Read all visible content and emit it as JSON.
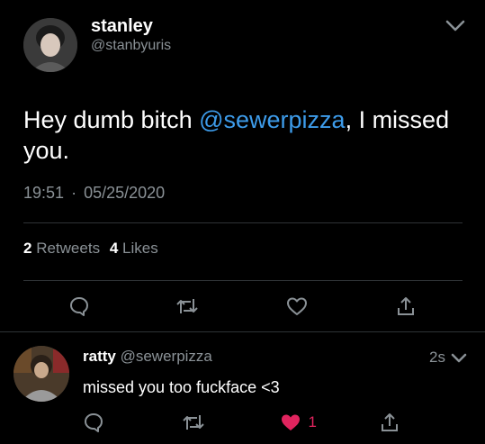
{
  "tweet": {
    "display_name": "stanley",
    "handle": "@stanbyuris",
    "text_before": "Hey dumb bitch ",
    "mention": "@sewerpizza",
    "text_after": ", I missed you.",
    "time": "19:51",
    "separator": "·",
    "date": "05/25/2020",
    "retweet_count": "2",
    "retweet_label": "Retweets",
    "like_count": "4",
    "like_label": "Likes"
  },
  "reply": {
    "display_name": "ratty",
    "handle": "@sewerpizza",
    "age": "2s",
    "text": "missed you too fuckface <3",
    "like_count": "1"
  },
  "colors": {
    "background": "#000000",
    "mention": "#3d9be9",
    "muted": "#8a9196",
    "like_active": "#e0245e",
    "divider": "#2f3336"
  },
  "icons": {
    "reply": "speech-bubble-icon",
    "retweet": "retweet-arrows-icon",
    "like": "heart-icon",
    "share": "share-upload-icon",
    "menu": "chevron-down-icon"
  }
}
